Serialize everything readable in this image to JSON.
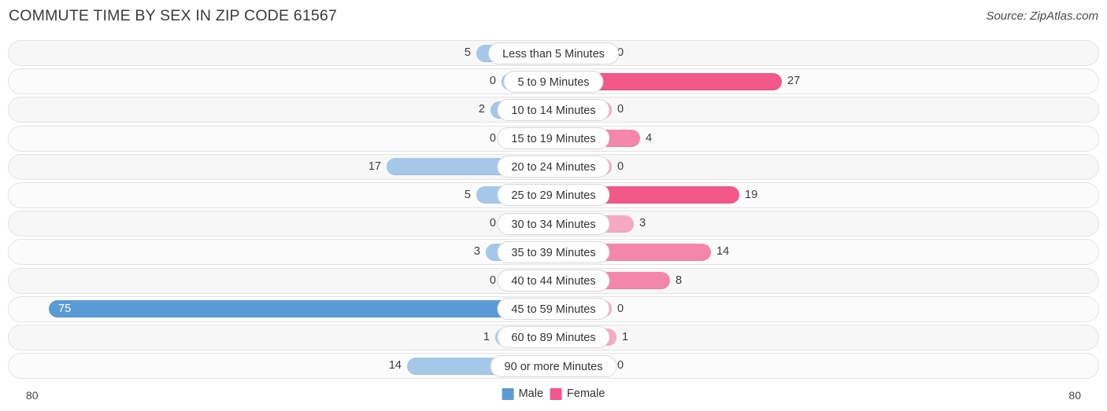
{
  "header": {
    "title": "COMMUTE TIME BY SEX IN ZIP CODE 61567",
    "source": "Source: ZipAtlas.com"
  },
  "legend": {
    "male_label": "Male",
    "female_label": "Female",
    "male_color": "#5b9bd5",
    "female_color": "#f2588a"
  },
  "axis": {
    "left_label": "80",
    "right_label": "80"
  },
  "chart_data": {
    "type": "bar",
    "title": "COMMUTE TIME BY SEX IN ZIP CODE 61567",
    "subtitle": "Source: ZipAtlas.com",
    "orientation": "horizontal-diverging",
    "xlabel": "",
    "ylabel": "",
    "xlim": [
      80,
      80
    ],
    "grid": false,
    "legend_position": "bottom-center",
    "categories": [
      "Less than 5 Minutes",
      "5 to 9 Minutes",
      "10 to 14 Minutes",
      "15 to 19 Minutes",
      "20 to 24 Minutes",
      "25 to 29 Minutes",
      "30 to 34 Minutes",
      "35 to 39 Minutes",
      "40 to 44 Minutes",
      "45 to 59 Minutes",
      "60 to 89 Minutes",
      "90 or more Minutes"
    ],
    "series": [
      {
        "name": "Male",
        "color": "#5b9bd5",
        "values": [
          5,
          0,
          2,
          0,
          17,
          5,
          0,
          3,
          0,
          75,
          1,
          14
        ]
      },
      {
        "name": "Female",
        "color": "#f2588a",
        "values": [
          0,
          27,
          0,
          4,
          0,
          19,
          3,
          14,
          8,
          0,
          1,
          0
        ]
      }
    ]
  },
  "rows": [
    {
      "label": "Less than 5 Minutes",
      "male": "5",
      "female": "0",
      "male_w": 98,
      "female_w": 74,
      "male_tone": "",
      "female_tone": "",
      "male_inside": false
    },
    {
      "label": "5 to 9 Minutes",
      "male": "0",
      "female": "27",
      "male_w": 66,
      "female_w": 290,
      "male_tone": "",
      "female_tone": "strong",
      "male_inside": false
    },
    {
      "label": "10 to 14 Minutes",
      "male": "2",
      "female": "0",
      "male_w": 80,
      "female_w": 74,
      "male_tone": "",
      "female_tone": "",
      "male_inside": false
    },
    {
      "label": "15 to 19 Minutes",
      "male": "0",
      "female": "4",
      "male_w": 66,
      "female_w": 110,
      "male_tone": "",
      "female_tone": "mid",
      "male_inside": false
    },
    {
      "label": "20 to 24 Minutes",
      "male": "17",
      "female": "0",
      "male_w": 212,
      "female_w": 74,
      "male_tone": "",
      "female_tone": "",
      "male_inside": false
    },
    {
      "label": "25 to 29 Minutes",
      "male": "5",
      "female": "19",
      "male_w": 98,
      "female_w": 236,
      "male_tone": "",
      "female_tone": "strong",
      "male_inside": false
    },
    {
      "label": "30 to 34 Minutes",
      "male": "0",
      "female": "3",
      "male_w": 66,
      "female_w": 102,
      "male_tone": "",
      "female_tone": "",
      "male_inside": false
    },
    {
      "label": "35 to 39 Minutes",
      "male": "3",
      "female": "14",
      "male_w": 86,
      "female_w": 200,
      "male_tone": "",
      "female_tone": "mid",
      "male_inside": false
    },
    {
      "label": "40 to 44 Minutes",
      "male": "0",
      "female": "8",
      "male_w": 66,
      "female_w": 148,
      "male_tone": "",
      "female_tone": "mid",
      "male_inside": false
    },
    {
      "label": "45 to 59 Minutes",
      "male": "75",
      "female": "0",
      "male_w": 641,
      "female_w": 74,
      "male_tone": "strong",
      "female_tone": "",
      "male_inside": true
    },
    {
      "label": "60 to 89 Minutes",
      "male": "1",
      "female": "1",
      "male_w": 74,
      "female_w": 80,
      "male_tone": "",
      "female_tone": "",
      "male_inside": false
    },
    {
      "label": "90 or more Minutes",
      "male": "14",
      "female": "0",
      "male_w": 186,
      "female_w": 74,
      "male_tone": "",
      "female_tone": "",
      "male_inside": false
    }
  ]
}
